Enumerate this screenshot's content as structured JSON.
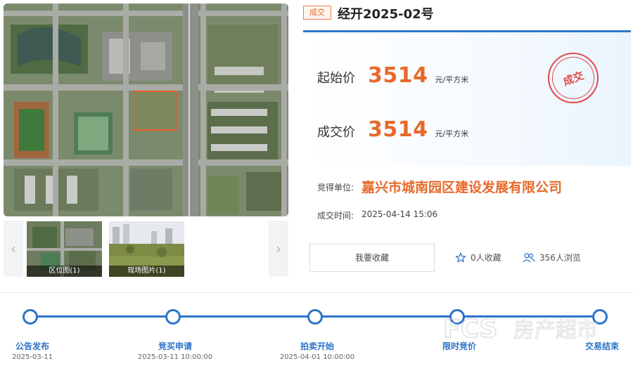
{
  "lot": {
    "status_tag": "成交",
    "title": "经开2025-02号",
    "stamp": "成交"
  },
  "prices": {
    "start_label": "起始价",
    "start_value": "3514",
    "start_unit": "元/平方米",
    "deal_label": "成交价",
    "deal_value": "3514",
    "deal_unit": "元/平方米"
  },
  "winner": {
    "label": "竞得单位:",
    "value": "嘉兴市城南园区建设发展有限公司"
  },
  "deal_time": {
    "label": "成交时间:",
    "value": "2025-04-14 15:06"
  },
  "actions": {
    "favorite_button": "我要收藏",
    "favorites_count": "0人收藏",
    "views_count": "356人浏览"
  },
  "gallery": {
    "thumbs": [
      {
        "caption": "区位图(1)"
      },
      {
        "caption": "现场图片(1)"
      }
    ],
    "prev_icon": "chevron-left-icon",
    "next_icon": "chevron-right-icon"
  },
  "timeline": [
    {
      "label": "公告发布",
      "date": "2025-03-11"
    },
    {
      "label": "竞买申请",
      "date": "2025-03-11 10:00:00"
    },
    {
      "label": "拍卖开始",
      "date": "2025-04-01 10:00:00"
    },
    {
      "label": "限时竞价",
      "date": ""
    },
    {
      "label": "交易结束",
      "date": ""
    }
  ],
  "watermark": "房产超市",
  "colors": {
    "accent": "#2d74c8",
    "price": "#e8692b",
    "stamp": "#e14b4b"
  }
}
